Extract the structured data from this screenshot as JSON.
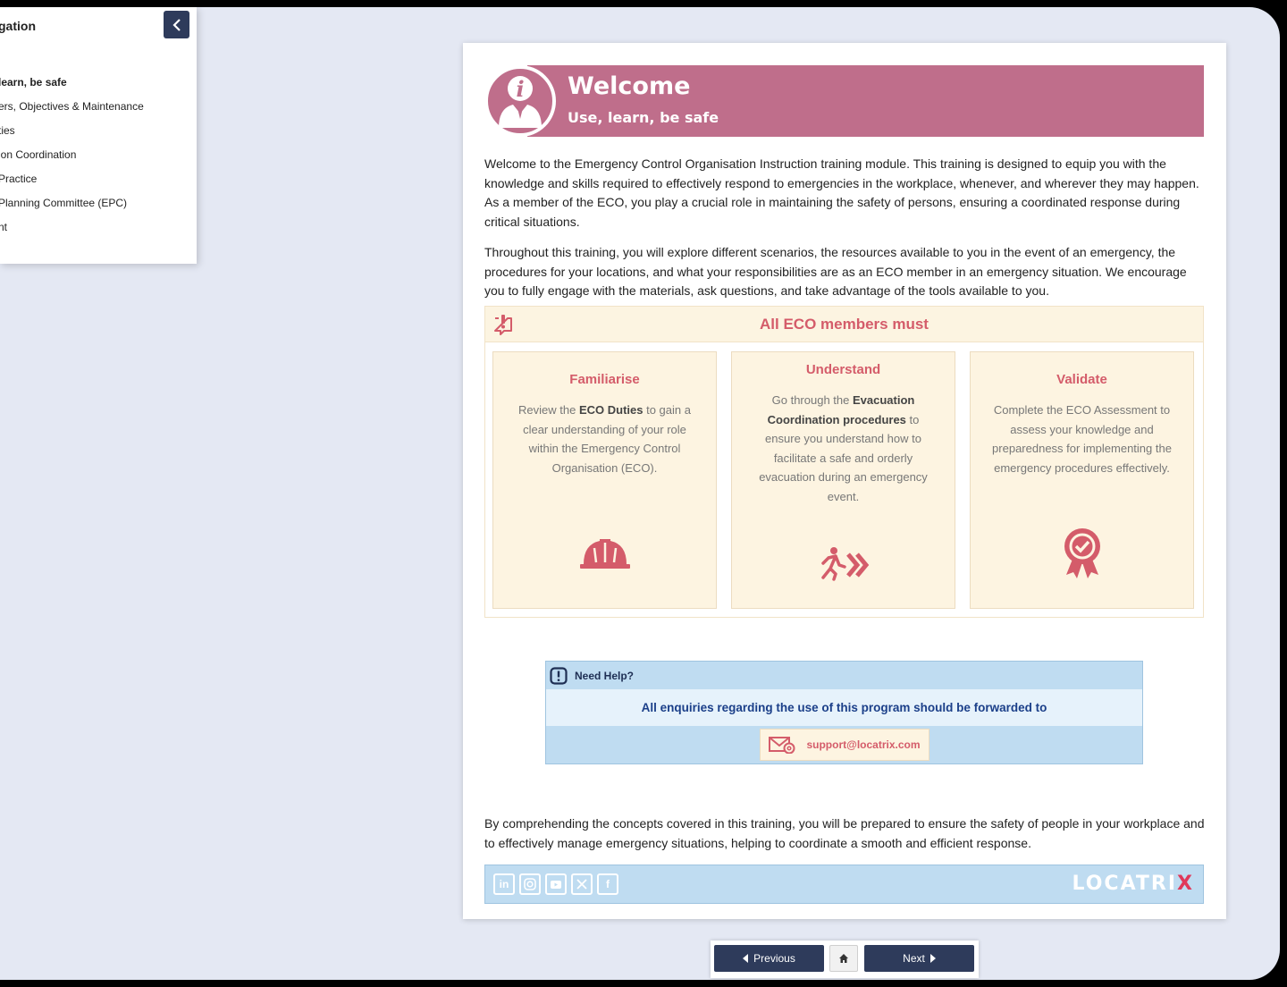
{
  "sidebar": {
    "title": "gation",
    "items": [
      {
        "label": " learn, be safe",
        "active": true
      },
      {
        "label": "ers, Objectives & Maintenance"
      },
      {
        "label": "ties"
      },
      {
        "label": "ion Coordination"
      },
      {
        "label": " Practice"
      },
      {
        "label": " Planning Committee (EPC)"
      },
      {
        "label": "nt"
      }
    ],
    "collapse_icon": "chevron-left-icon"
  },
  "banner": {
    "title": "Welcome",
    "subtitle": "Use, learn, be safe",
    "icon": "info-person-icon"
  },
  "intro": {
    "p1": "Welcome to the Emergency Control Organisation Instruction training module. This training is designed to equip you with the knowledge and skills required to effectively respond to emergencies in the workplace, whenever, and wherever they may happen. As a member of the ECO, you play a crucial role in maintaining  the safety of persons, ensuring a coordinated response during critical situations.",
    "p2": "Throughout this training, you will explore different scenarios, the resources available to you in the event of an emergency, the procedures for your locations, and what your responsibilities are as an ECO member in an emergency situation. We encourage you to fully engage with the materials, ask questions, and take advantage of the tools available to you."
  },
  "members": {
    "title": "All ECO members must",
    "boxes": [
      {
        "title": "Familiarise",
        "text_pre": "Review the ",
        "text_bold": "ECO Duties",
        "text_post": " to gain a clear understanding of your role within the Emergency Control Organisation (ECO).",
        "icon": "hard-hat-icon"
      },
      {
        "title": "Understand",
        "text_pre": "Go through the ",
        "text_bold": "Evacuation Coordination procedures",
        "text_post": " to ensure you understand how to facilitate a safe and orderly evacuation during an emergency event.",
        "icon": "running-exit-icon"
      },
      {
        "title": "Validate",
        "text_pre": "Complete the ECO Assessment to assess your knowledge and preparedness for implementing the emergency procedures effectively.",
        "text_bold": "",
        "text_post": "",
        "icon": "award-ribbon-icon"
      }
    ]
  },
  "help": {
    "title": "Need Help?",
    "message": "All enquiries regarding the use of this program should be forwarded to",
    "email": "support@locatrix.com"
  },
  "closing": "By comprehending the concepts covered in this training, you will be prepared to ensure the safety of people in your workplace and to effectively manage emergency situations, helping to coordinate a smooth and efficient response.",
  "footer": {
    "socials": [
      "in",
      "ig",
      "yt",
      "X",
      "f"
    ],
    "brand_main": "LOCATRI",
    "brand_accent": "X"
  },
  "pager": {
    "previous": "Previous",
    "next": "Next"
  },
  "colors": {
    "accent": "#bf6e8b",
    "heading_red": "#d45c6a",
    "navy": "#2e3b5b",
    "help_blue": "#bfdcf1"
  }
}
